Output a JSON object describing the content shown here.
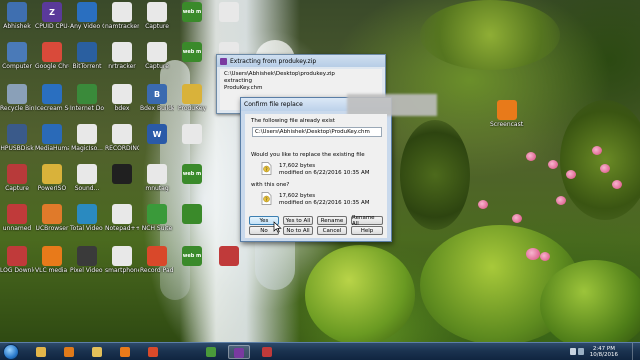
{
  "desktop": {
    "icons": [
      {
        "label": "Abhishek",
        "color": "#3f6fb0",
        "glyph": "",
        "col": 0,
        "row": 0
      },
      {
        "label": "CPUID CPU-Z",
        "color": "#5a3a9a",
        "glyph": "Z",
        "col": 1,
        "row": 0
      },
      {
        "label": "Any Video Converter",
        "color": "#2a6fc0",
        "glyph": "",
        "col": 2,
        "row": 0
      },
      {
        "label": "namtracker",
        "color": "#e8e8e8",
        "glyph": "",
        "col": 3,
        "row": 0
      },
      {
        "label": "Capture",
        "color": "#e8e8e8",
        "glyph": "",
        "col": 4,
        "row": 0
      },
      {
        "label": "",
        "color": "#3a8a2a",
        "glyph": "web m",
        "col": 5,
        "row": 0
      },
      {
        "label": "",
        "color": "#e8e8e8",
        "glyph": "",
        "col": 6,
        "row": 0
      },
      {
        "label": "Computer",
        "color": "#4a7ab8",
        "glyph": "",
        "col": 0,
        "row": 1
      },
      {
        "label": "Google Chrome",
        "color": "#d94a3a",
        "glyph": "",
        "col": 1,
        "row": 1
      },
      {
        "label": "BitTorrent",
        "color": "#2a5fa0",
        "glyph": "",
        "col": 2,
        "row": 1
      },
      {
        "label": "nrtracker",
        "color": "#e8e8e8",
        "glyph": "",
        "col": 3,
        "row": 1
      },
      {
        "label": "Capture",
        "color": "#e8e8e8",
        "glyph": "",
        "col": 4,
        "row": 1
      },
      {
        "label": "",
        "color": "#3a8a2a",
        "glyph": "web m",
        "col": 5,
        "row": 1
      },
      {
        "label": "",
        "color": "#e8e8e8",
        "glyph": "",
        "col": 6,
        "row": 1
      },
      {
        "label": "Recycle Bin",
        "color": "#8aa0b8",
        "glyph": "",
        "col": 0,
        "row": 2
      },
      {
        "label": "Icecream Screen",
        "color": "#2a6fc0",
        "glyph": "",
        "col": 1,
        "row": 2
      },
      {
        "label": "Internet Downlo...",
        "color": "#3a8a3a",
        "glyph": "",
        "col": 2,
        "row": 2
      },
      {
        "label": "bdex",
        "color": "#e8e8e8",
        "glyph": "",
        "col": 3,
        "row": 2
      },
      {
        "label": "Bdex Builder",
        "color": "#3a6ab0",
        "glyph": "B",
        "col": 4,
        "row": 2
      },
      {
        "label": "ProduKey",
        "color": "#d9b23a",
        "glyph": "",
        "col": 5,
        "row": 2
      },
      {
        "label": "HPUSBDisk",
        "color": "#3a5a8a",
        "glyph": "",
        "col": 0,
        "row": 3
      },
      {
        "label": "MediaHuman YouTube...",
        "color": "#2a6ab8",
        "glyph": "",
        "col": 1,
        "row": 3
      },
      {
        "label": "MagicIso...",
        "color": "#e8e8e8",
        "glyph": "",
        "col": 2,
        "row": 3
      },
      {
        "label": "RECORDING...",
        "color": "#e8e8e8",
        "glyph": "",
        "col": 3,
        "row": 3
      },
      {
        "label": "",
        "color": "#2a5aa8",
        "glyph": "W",
        "col": 4,
        "row": 3
      },
      {
        "label": "",
        "color": "#e8e8e8",
        "glyph": "",
        "col": 5,
        "row": 3
      },
      {
        "label": "Capture",
        "color": "#b83a3a",
        "glyph": "",
        "col": 0,
        "row": 4
      },
      {
        "label": "PowerISO",
        "color": "#d9b23a",
        "glyph": "",
        "col": 1,
        "row": 4
      },
      {
        "label": "Sound...",
        "color": "#e8e8e8",
        "glyph": "",
        "col": 2,
        "row": 4
      },
      {
        "label": "",
        "color": "#202020",
        "glyph": "",
        "col": 3,
        "row": 4
      },
      {
        "label": "mnutag",
        "color": "#e8e8e8",
        "glyph": "",
        "col": 4,
        "row": 4
      },
      {
        "label": "",
        "color": "#3a8a2a",
        "glyph": "web m",
        "col": 5,
        "row": 4
      },
      {
        "label": "unnamed",
        "color": "#c03a3a",
        "glyph": "",
        "col": 0,
        "row": 5
      },
      {
        "label": "UCBrowser",
        "color": "#e07a2a",
        "glyph": "",
        "col": 1,
        "row": 5
      },
      {
        "label": "Total Video Converter",
        "color": "#2a8ac0",
        "glyph": "",
        "col": 2,
        "row": 5
      },
      {
        "label": "Notepad++",
        "color": "#e8e8e8",
        "glyph": "",
        "col": 3,
        "row": 5
      },
      {
        "label": "NCH Suite",
        "color": "#3a9a3a",
        "glyph": "",
        "col": 4,
        "row": 5
      },
      {
        "label": "",
        "color": "#3a8a2a",
        "glyph": "",
        "col": 5,
        "row": 5
      },
      {
        "label": "LOG Downloads",
        "color": "#c03a3a",
        "glyph": "",
        "col": 0,
        "row": 6
      },
      {
        "label": "VLC media player",
        "color": "#e87a1a",
        "glyph": "",
        "col": 1,
        "row": 6
      },
      {
        "label": "Pixel Video Maker",
        "color": "#3a3a3a",
        "glyph": "",
        "col": 2,
        "row": 6
      },
      {
        "label": "smartphone",
        "color": "#e8e8e8",
        "glyph": "",
        "col": 3,
        "row": 6
      },
      {
        "label": "Record Pad Recorder",
        "color": "#d9482a",
        "glyph": "",
        "col": 4,
        "row": 6
      },
      {
        "label": "",
        "color": "#3a8a2a",
        "glyph": "web m",
        "col": 5,
        "row": 6
      },
      {
        "label": "",
        "color": "#c03a3a",
        "glyph": "",
        "col": 6,
        "row": 6
      },
      {
        "label": "Screencast...",
        "color": "#e87a1a",
        "glyph": "",
        "col": 14,
        "row": 2
      }
    ]
  },
  "extract_dialog": {
    "title": "Extracting from produkey.zip",
    "path": "C:\\Users\\Abhishek\\Desktop\\produkey.zip",
    "status": "extracting",
    "file": "ProduKey.chm"
  },
  "confirm_dialog": {
    "title": "Confirm file replace",
    "intro": "The following file already exist",
    "path": "C:\\Users\\Abhishek\\Desktop\\ProduKey.chm",
    "question": "Would you like to replace the existing file",
    "existing_size": "17,602 bytes",
    "existing_modified": "modified on 6/22/2016 10:35 AM",
    "with_text": "with this one?",
    "new_size": "17,602 bytes",
    "new_modified": "modified on 6/22/2016 10:35 AM",
    "buttons": {
      "yes": "Yes",
      "yes_to_all": "Yes to All",
      "rename": "Rename",
      "rename_all": "Rename All",
      "no": "No",
      "no_to_all": "No to All",
      "cancel": "Cancel",
      "help": "Help"
    }
  },
  "taskbar": {
    "items": [
      {
        "icon": "explorer-icon",
        "color": "#e3b64a"
      },
      {
        "icon": "media-player-icon",
        "color": "#e07a1a"
      },
      {
        "icon": "folder-icon",
        "color": "#e3c05a"
      },
      {
        "icon": "vlc-icon",
        "color": "#e87a1a"
      },
      {
        "icon": "record-icon",
        "color": "#d94a2a"
      },
      {
        "icon": "chrome-icon",
        "color": "#4a9a3a"
      },
      {
        "icon": "winrar-icon",
        "color": "#7a3aa0"
      },
      {
        "icon": "recorder-icon",
        "color": "#c03a3a"
      }
    ],
    "clock_time": "2:47 PM",
    "clock_date": "10/8/2016"
  }
}
